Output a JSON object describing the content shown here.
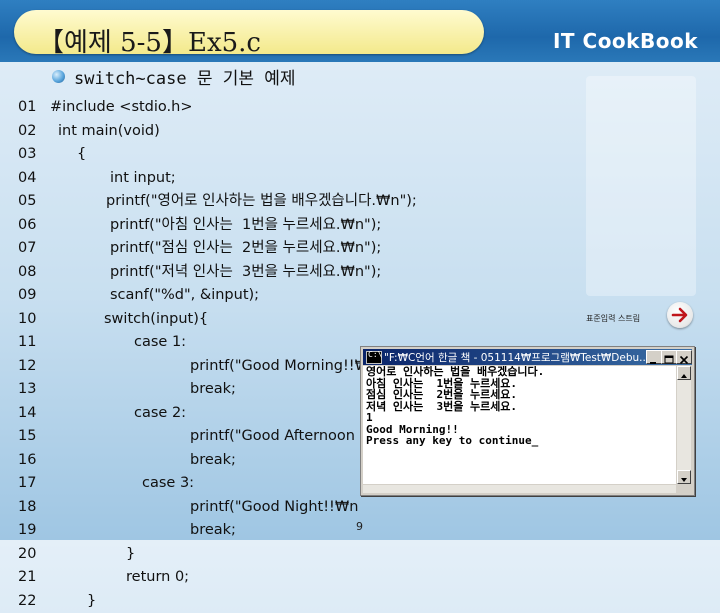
{
  "header": {
    "title": "【예제 5-5】Ex5.c",
    "brand": "IT CookBook"
  },
  "subtitle": "switch~case 문 기본 예제",
  "code": {
    "lines": [
      {
        "num": "01",
        "text": "#include <stdio.h>"
      },
      {
        "num": "02",
        "text": "int main(void)"
      },
      {
        "num": "03",
        "text": "{"
      },
      {
        "num": "04",
        "text": "int input;"
      },
      {
        "num": "05",
        "text": "printf(\"영어로 인사하는 법을 배우겠습니다.₩n\");"
      },
      {
        "num": "06",
        "text": "printf(\"아침 인사는  1번을 누르세요.₩n\");"
      },
      {
        "num": "07",
        "text": "printf(\"점심 인사는  2번을 누르세요.₩n\");"
      },
      {
        "num": "08",
        "text": "printf(\"저녁 인사는  3번을 누르세요.₩n\");"
      },
      {
        "num": "09",
        "text": "scanf(\"%d\", &input);"
      },
      {
        "num": "10",
        "text": "switch(input){"
      },
      {
        "num": "11",
        "text": "case 1:"
      },
      {
        "num": "12",
        "text": "printf(\"Good Morning!!₩n\");"
      },
      {
        "num": "13",
        "text": "break;"
      },
      {
        "num": "14",
        "text": "case 2:"
      },
      {
        "num": "15",
        "text": "printf(\"Good Afternoon"
      },
      {
        "num": "16",
        "text": "break;"
      },
      {
        "num": "17",
        "text": "case 3:"
      },
      {
        "num": "18",
        "text": "printf(\"Good Night!!₩n"
      },
      {
        "num": "19",
        "text": "break;"
      },
      {
        "num": "20",
        "text": "}"
      },
      {
        "num": "21",
        "text": "return 0;"
      },
      {
        "num": "22",
        "text": "}"
      }
    ]
  },
  "side": {
    "hint": "표준입력 스트림",
    "arrow_icon": "arrow-right-icon"
  },
  "console": {
    "title": "\"F:₩C언어 한글 책 - 051114₩프로그램₩Test₩Debu...",
    "lines": [
      "영어로 인사하는 법을 배우겠습니다.",
      "아침 인사는  1번을 누르세요.",
      "점심 인사는  2번을 누르세요.",
      "저녁 인사는  3번을 누르세요.",
      "1",
      "Good Morning!!",
      "Press any key to continue_"
    ]
  },
  "footer": {
    "page": "9"
  },
  "colors": {
    "title_bar": "#1e68ab",
    "title_pill": "#f3e98b",
    "console_titlebar": "#0a246a"
  }
}
